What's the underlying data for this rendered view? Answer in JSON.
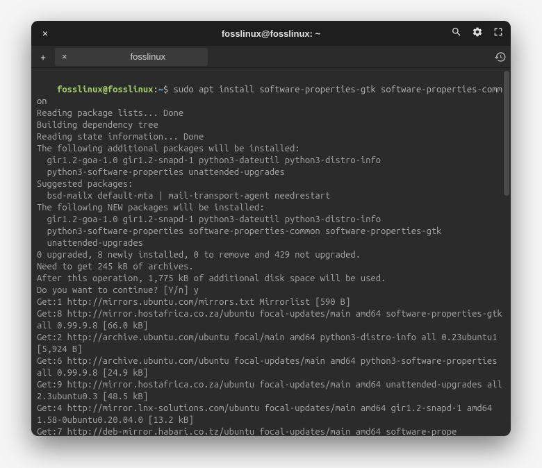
{
  "titlebar": {
    "close_glyph": "×",
    "title": "fosslinux@fosslinux: ~"
  },
  "tabbar": {
    "add_glyph": "+",
    "tab_close_glyph": "×",
    "tab_label": "fosslinux"
  },
  "prompt": {
    "user_host": "fosslinux@fosslinux",
    "separator": ":",
    "path": "~",
    "dollar": "$"
  },
  "command": "sudo apt install software-properties-gtk software-properties-common",
  "output_lines": [
    "Reading package lists... Done",
    "Building dependency tree",
    "Reading state information... Done",
    "The following additional packages will be installed:",
    "  gir1.2-goa-1.0 gir1.2-snapd-1 python3-dateutil python3-distro-info",
    "  python3-software-properties unattended-upgrades",
    "Suggested packages:",
    "  bsd-mailx default-mta | mail-transport-agent needrestart",
    "The following NEW packages will be installed:",
    "  gir1.2-goa-1.0 gir1.2-snapd-1 python3-dateutil python3-distro-info",
    "  python3-software-properties software-properties-common software-properties-gtk",
    "  unattended-upgrades",
    "0 upgraded, 8 newly installed, 0 to remove and 429 not upgraded.",
    "Need to get 245 kB of archives.",
    "After this operation, 1,775 kB of additional disk space will be used.",
    "Do you want to continue? [Y/n] y",
    "Get:1 http://mirrors.ubuntu.com/mirrors.txt Mirrorlist [590 B]",
    "Get:8 http://mirror.hostafrica.co.za/ubuntu focal-updates/main amd64 software-properties-gtk all 0.99.9.8 [66.0 kB]",
    "Get:2 http://archive.ubuntu.com/ubuntu focal/main amd64 python3-distro-info all 0.23ubuntu1 [5,924 B]",
    "Get:6 http://archive.ubuntu.com/ubuntu focal-updates/main amd64 python3-software-properties all 0.99.9.8 [24.9 kB]",
    "Get:9 http://mirror.hostafrica.co.za/ubuntu focal-updates/main amd64 unattended-upgrades all 2.3ubuntu0.3 [48.5 kB]",
    "Get:4 http://mirror.lnx-solutions.com/ubuntu focal-updates/main amd64 gir1.2-snapd-1 amd64 1.58-0ubuntu0.20.04.0 [13.2 kB]",
    "Get:7 http://deb-mirror.habari.co.tz/ubuntu focal-updates/main amd64 software-prope"
  ]
}
